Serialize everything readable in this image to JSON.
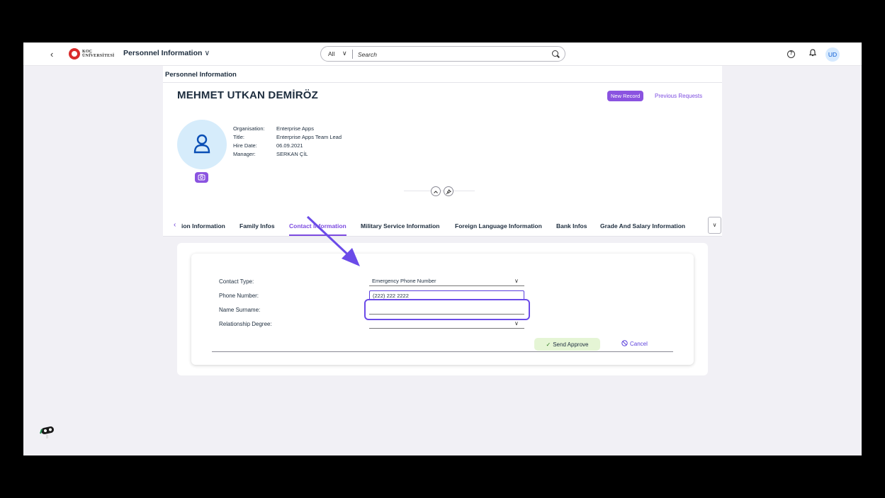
{
  "shell": {
    "back_symbol": "‹",
    "logo_line1": "KOÇ",
    "logo_line2": "ÜNİVERSİTESİ",
    "app_title": "Personnel Information",
    "app_title_chevron": "∨",
    "search_scope": "All",
    "search_scope_chevron": "∨",
    "search_placeholder": "Search",
    "help_symbol": "?",
    "bell_symbol": "🔔",
    "avatar_initials": "UD"
  },
  "page": {
    "header_title": "Personnel Information"
  },
  "employee": {
    "name": "MEHMET UTKAN DEMİRÖZ",
    "new_record_label": "New Record",
    "previous_requests_label": "Previous Requests",
    "fields": [
      {
        "label": "Organisation:",
        "value": "Enterprise Apps"
      },
      {
        "label": "Title:",
        "value": "Enterprise Apps Team Lead"
      },
      {
        "label": "Hire Date:",
        "value": "06.09.2021"
      },
      {
        "label": "Manager:",
        "value": "SERKAN ÇİL"
      }
    ]
  },
  "tabs": {
    "prev_symbol": "‹",
    "items": [
      {
        "label": "ion Information"
      },
      {
        "label": "Family Infos"
      },
      {
        "label": "Contact Information"
      },
      {
        "label": "Military Service Information"
      },
      {
        "label": "Foreign Language Information"
      },
      {
        "label": "Bank Infos"
      },
      {
        "label": "Grade And Salary Information"
      }
    ],
    "active_index": 2,
    "overflow_symbol": "∨"
  },
  "form": {
    "contact_type_label": "Contact Type:",
    "contact_type_value": "Emergency Phone Number",
    "phone_label": "Phone Number:",
    "phone_value": "(222) 222 2222",
    "name_label": "Name Surname:",
    "name_value": "",
    "relationship_label": "Relationship Degree:",
    "relationship_value": "",
    "caret_symbol": "∨",
    "send_approve_label": "Send Approve",
    "send_check": "✓",
    "cancel_label": "Cancel",
    "cancel_symbol": "⃠"
  },
  "colors": {
    "accent": "#7c4be0",
    "button_purple": "#8a53e0",
    "highlight": "#6b4be8",
    "send_bg": "#e5f5d5"
  }
}
